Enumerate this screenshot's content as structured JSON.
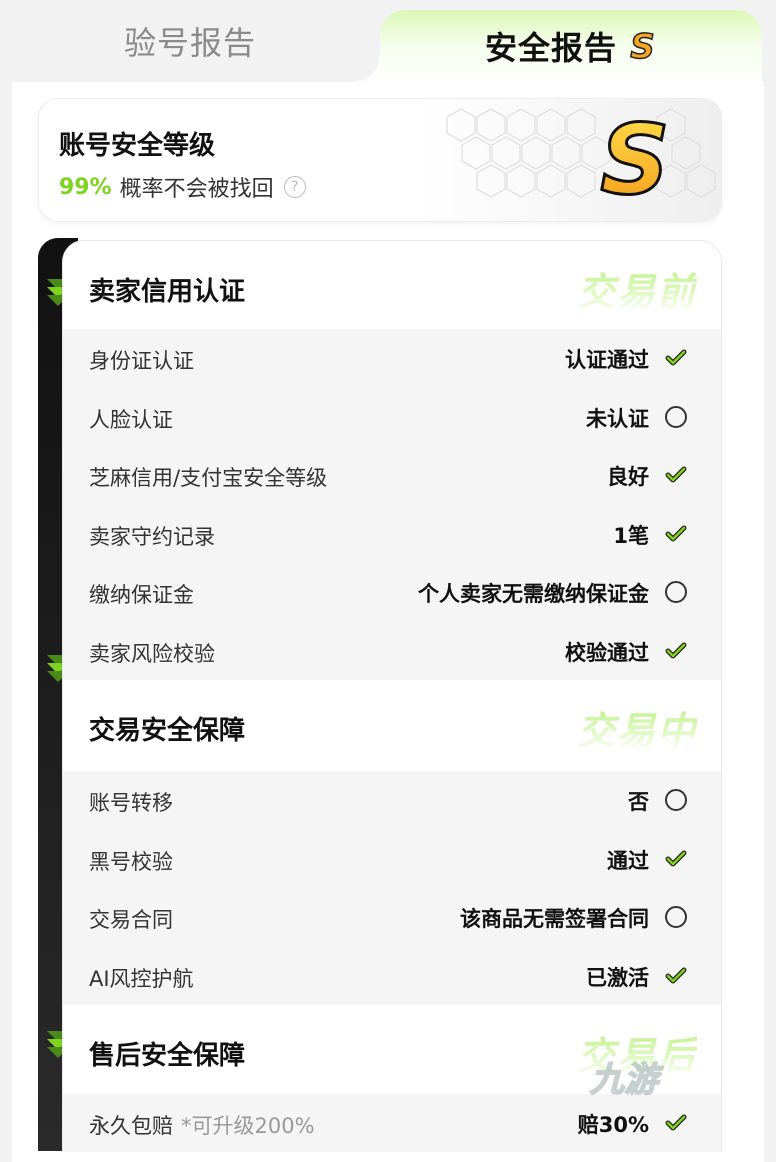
{
  "tabs": {
    "inspection": "验号报告",
    "security": "安全报告"
  },
  "level_card": {
    "title": "账号安全等级",
    "percent": "99%",
    "description": "概率不会被找回",
    "help_glyph": "?",
    "grade": "S"
  },
  "sections": [
    {
      "title": "卖家信用认证",
      "stage": "交易前",
      "rows": [
        {
          "label": "身份证认证",
          "value": "认证通过",
          "status": "check"
        },
        {
          "label": "人脸认证",
          "value": "未认证",
          "status": "circle"
        },
        {
          "label": "芝麻信用/支付宝安全等级",
          "value": "良好",
          "status": "check"
        },
        {
          "label": "卖家守约记录",
          "value": "1笔",
          "status": "check"
        },
        {
          "label": "缴纳保证金",
          "value": "个人卖家无需缴纳保证金",
          "status": "circle"
        },
        {
          "label": "卖家风险校验",
          "value": "校验通过",
          "status": "check"
        }
      ]
    },
    {
      "title": "交易安全保障",
      "stage": "交易中",
      "rows": [
        {
          "label": "账号转移",
          "value": "否",
          "status": "circle"
        },
        {
          "label": "黑号校验",
          "value": "通过",
          "status": "check"
        },
        {
          "label": "交易合同",
          "value": "该商品无需签署合同",
          "status": "circle"
        },
        {
          "label": "AI风控护航",
          "value": "已激活",
          "status": "check"
        }
      ]
    },
    {
      "title": "售后安全保障",
      "stage": "交易后",
      "rows": [
        {
          "label": "永久包赔",
          "note": "*可升级200%",
          "value": "赔30%",
          "status": "check"
        }
      ]
    }
  ],
  "watermark": "九游",
  "colors": {
    "accent": "#7ed321",
    "check": "#5aa81a"
  }
}
